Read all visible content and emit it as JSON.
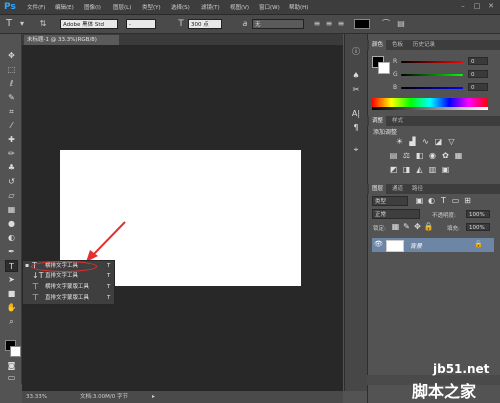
{
  "menubar": {
    "logo": "Ps",
    "items": [
      "文件(F)",
      "编辑(E)",
      "图像(I)",
      "图层(L)",
      "类型(Y)",
      "选择(S)",
      "滤镜(T)",
      "视图(V)",
      "窗口(W)",
      "帮助(H)"
    ],
    "controls": [
      "–",
      "□",
      "✕"
    ]
  },
  "options": {
    "font_family": "Adobe 黑体 Std",
    "font_style": "-",
    "font_size": "300 点",
    "anti_alias_prefix": "a",
    "anti_alias": "无",
    "text_color": "#000000"
  },
  "document": {
    "tab_title": "未标题-1 @ 33.3%(RGB/8)",
    "zoom": "33.33%",
    "doc_info": "文档:3.00M/0 字节",
    "canvas_color": "#ffffff"
  },
  "toolbox": {
    "icons": [
      "move-icon",
      "marquee-icon",
      "lasso-icon",
      "quick-select-icon",
      "crop-icon",
      "eyedropper-icon",
      "spot-heal-icon",
      "brush-icon",
      "clone-stamp-icon",
      "history-brush-icon",
      "eraser-icon",
      "gradient-icon",
      "blur-icon",
      "dodge-icon",
      "pen-icon",
      "type-icon",
      "path-select-icon",
      "rectangle-icon",
      "hand-icon",
      "zoom-icon"
    ]
  },
  "flyout": {
    "items": [
      {
        "label": "横排文字工具",
        "key": "T",
        "active": true
      },
      {
        "label": "直排文字工具",
        "key": "T",
        "active": false
      },
      {
        "label": "横排文字蒙版工具",
        "key": "T",
        "active": false
      },
      {
        "label": "直排文字蒙版工具",
        "key": "T",
        "active": false
      }
    ]
  },
  "color_panel": {
    "tabs": [
      "颜色",
      "色板",
      "历史记录"
    ],
    "channels": [
      {
        "label": "R",
        "value": "0",
        "color": "#d03030"
      },
      {
        "label": "G",
        "value": "0",
        "color": "#30b030"
      },
      {
        "label": "B",
        "value": "0",
        "color": "#3050d0"
      }
    ]
  },
  "adjustments_panel": {
    "tabs": [
      "调整",
      "样式"
    ],
    "title": "添加调整"
  },
  "layers_panel": {
    "tabs": [
      "图层",
      "通道",
      "路径"
    ],
    "kind_label": "类型",
    "blend_mode": "正常",
    "opacity_label": "不透明度:",
    "opacity_value": "100%",
    "lock_label": "锁定:",
    "fill_label": "填充:",
    "fill_value": "100%",
    "layer_name": "背景"
  },
  "watermark": {
    "site": "jb51.net",
    "brand": "脚本之家"
  },
  "colors": {
    "accent_red": "#e53030",
    "selected_layer": "#6d86a6"
  }
}
